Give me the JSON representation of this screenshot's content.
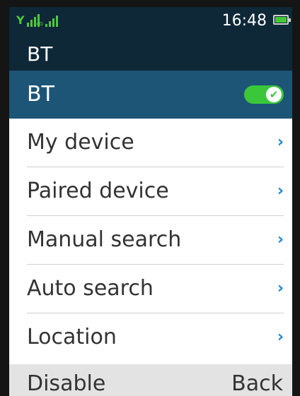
{
  "status_bar": {
    "network_label": "4G",
    "time": "16:48"
  },
  "header": {
    "title": "BT"
  },
  "bt_row": {
    "label": "BT",
    "enabled": true
  },
  "menu": {
    "items": [
      {
        "label": "My device"
      },
      {
        "label": "Paired device"
      },
      {
        "label": "Manual search"
      },
      {
        "label": "Auto search"
      },
      {
        "label": "Location"
      }
    ]
  },
  "softkeys": {
    "left": "Disable",
    "right": "Back"
  },
  "colors": {
    "header_bg": "#0e2838",
    "selected_row_bg": "#1d5577",
    "toggle_on": "#3ac83a",
    "chevron": "#1a7fd1",
    "signal": "#4ec93a",
    "battery": "#46c83a"
  },
  "icons": {
    "signal_1": "signal-bars-icon",
    "signal_2": "signal-bars-4g-icon",
    "battery": "battery-full-icon",
    "toggle_check": "checkmark-icon",
    "row_arrow": "chevron-right-icon"
  }
}
